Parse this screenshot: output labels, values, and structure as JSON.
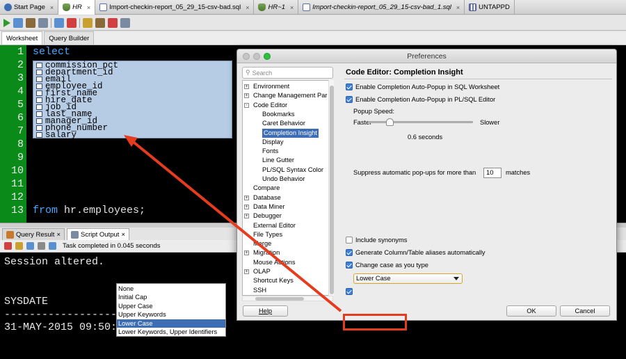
{
  "doc_tabs": [
    {
      "label": "Start Page",
      "italic": false
    },
    {
      "label": "HR",
      "italic": true
    },
    {
      "label": "Import-checkin-report_05_29_15-csv-bad.sql",
      "italic": false
    },
    {
      "label": "HR~1",
      "italic": true
    },
    {
      "label": "Import-checkin-report_05_29_15-csv-bad_1.sql",
      "italic": true
    },
    {
      "label": "UNTAPPD",
      "italic": false
    }
  ],
  "worksheet_tabs": {
    "worksheet": "Worksheet",
    "query_builder": "Query Builder"
  },
  "editor": {
    "line_numbers": [
      "1",
      "2",
      "3",
      "4",
      "5",
      "6",
      "7",
      "8",
      "9",
      "10",
      "11",
      "12",
      "13"
    ],
    "line1": "select",
    "line13_from": "from",
    "line13_rest": " hr.employees;",
    "completions": [
      "commission_pct",
      "department_id",
      "email",
      "employee_id",
      "first_name",
      "hire_date",
      "job_id",
      "last_name",
      "manager_id",
      "phone_number",
      "salary"
    ]
  },
  "results": {
    "tab_query": "Query Result",
    "tab_script": "Script Output",
    "status": "Task completed in 0.045 seconds",
    "output_lines": [
      "Session altered.",
      "",
      "",
      "SYSDATE",
      "--------------------",
      "31-MAY-2015 09:50:09"
    ]
  },
  "dialog": {
    "title": "Preferences",
    "search_placeholder": "Search",
    "tree": [
      {
        "label": "Environment",
        "expander": "+"
      },
      {
        "label": "Change Management Par",
        "expander": "+"
      },
      {
        "label": "Code Editor",
        "expander": "-"
      },
      {
        "label": "Bookmarks",
        "expander": ""
      },
      {
        "label": "Caret Behavior",
        "expander": ""
      },
      {
        "label": "Completion Insight",
        "expander": ""
      },
      {
        "label": "Display",
        "expander": ""
      },
      {
        "label": "Fonts",
        "expander": ""
      },
      {
        "label": "Line Gutter",
        "expander": ""
      },
      {
        "label": "PL/SQL Syntax Color",
        "expander": ""
      },
      {
        "label": "Undo Behavior",
        "expander": ""
      },
      {
        "label": "Compare",
        "expander": ""
      },
      {
        "label": "Database",
        "expander": "+"
      },
      {
        "label": "Data Miner",
        "expander": "+"
      },
      {
        "label": "Debugger",
        "expander": "+"
      },
      {
        "label": "External Editor",
        "expander": ""
      },
      {
        "label": "File Types",
        "expander": ""
      },
      {
        "label": "Merge",
        "expander": ""
      },
      {
        "label": "Migration",
        "expander": "+"
      },
      {
        "label": "Mouse Actions",
        "expander": ""
      },
      {
        "label": "OLAP",
        "expander": "+"
      },
      {
        "label": "Shortcut Keys",
        "expander": ""
      },
      {
        "label": "SSH",
        "expander": ""
      }
    ],
    "panel_title": "Code Editor: Completion Insight",
    "enable_auto_popup_sql": "Enable Completion Auto-Popup in SQL Worksheet",
    "enable_auto_popup_plsql": "Enable Completion Auto-Popup in PL/SQL Editor",
    "popup_speed_label": "Popup Speed:",
    "faster": "Faster",
    "slower": "Slower",
    "speed_value": "0.6 seconds",
    "speed_level": 0.19,
    "suppress_label": "Suppress automatic pop-ups for more than",
    "suppress_value": "10",
    "matches": "matches",
    "include_synonyms": "Include synonyms",
    "generate_aliases": "Generate Column/Table aliases automatically",
    "change_case": "Change case as you type",
    "case_selected": "Lower Case",
    "case_options": [
      "None",
      "Initial Cap",
      "Upper Case",
      "Upper Keywords",
      "Lower Case",
      "Lower Keywords, Upper Identifiers"
    ],
    "help": "Help",
    "ok": "OK",
    "cancel": "Cancel"
  },
  "colors": {
    "accent": "#3d6db5",
    "annotation": "#e53b1e",
    "gutter": "#0a8a18"
  }
}
